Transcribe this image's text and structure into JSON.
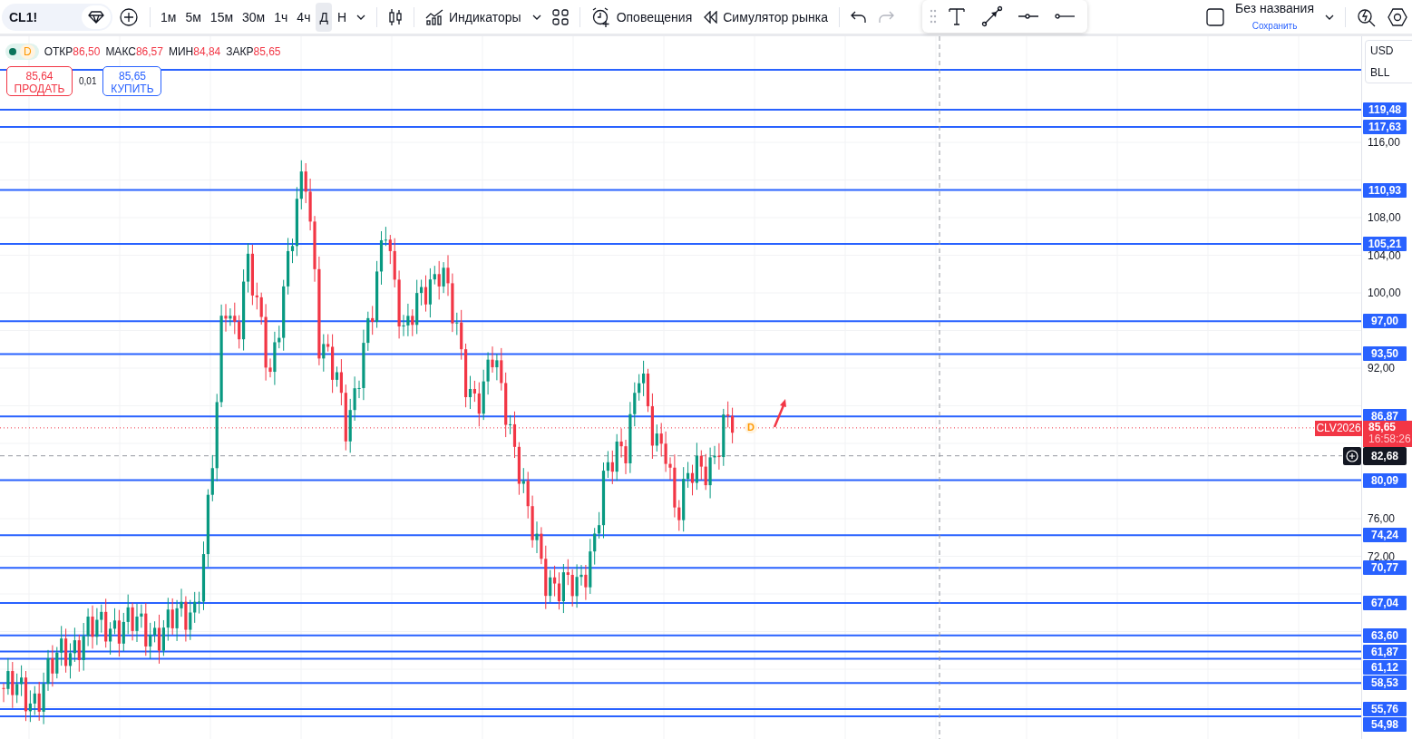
{
  "toolbar": {
    "symbol": "CL1!",
    "intervals": [
      {
        "label": "1м",
        "selected": false
      },
      {
        "label": "5м",
        "selected": false
      },
      {
        "label": "15м",
        "selected": false
      },
      {
        "label": "30м",
        "selected": false
      },
      {
        "label": "1ч",
        "selected": false
      },
      {
        "label": "4ч",
        "selected": false
      },
      {
        "label": "Д",
        "selected": true
      },
      {
        "label": "Н",
        "selected": false
      }
    ],
    "indicators_label": "Индикаторы",
    "alerts_label": "Оповещения",
    "replay_label": "Симулятор рынка",
    "redo": {
      "disabled": true
    },
    "layout_title": "Без названия",
    "save_label": "Сохранить"
  },
  "legend": {
    "interval": "D",
    "fields": [
      {
        "label": "ОТКР",
        "value": "86,50"
      },
      {
        "label": "МАКС",
        "value": "86,57"
      },
      {
        "label": "МИН",
        "value": "84,84"
      },
      {
        "label": "ЗАКР",
        "value": "85,65"
      }
    ]
  },
  "trade": {
    "sell_price": "85,64",
    "sell_label": "ПРОДАТЬ",
    "spread": "0,01",
    "buy_price": "85,65",
    "buy_label": "КУПИТЬ"
  },
  "chart": {
    "event_marker": "D"
  },
  "price_axis": {
    "currency": "USD",
    "unit": "BLL",
    "ticks": [
      "116,00",
      "108,00",
      "104,00",
      "100,00",
      "92,00",
      "76,00",
      "72,00"
    ],
    "levels": [
      "119,48",
      "117,63",
      "110,93",
      "105,21",
      "97,00",
      "93,50",
      "86,87",
      "80,09",
      "74,24",
      "70,77",
      "67,04",
      "63,60",
      "61,87",
      "61,12",
      "58,53",
      "55,76",
      "54,98"
    ],
    "current": {
      "symbol": "CLV2026",
      "price": "85,65",
      "countdown": "16:58:26"
    },
    "crosshair": "82,68"
  }
}
